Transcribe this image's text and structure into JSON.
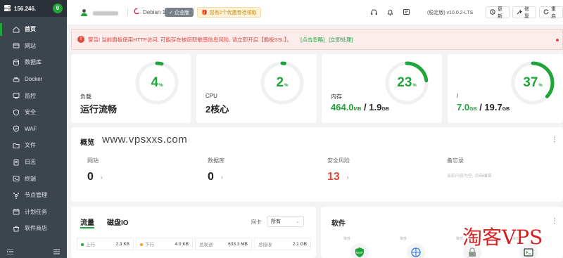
{
  "sidebar": {
    "server_ip": "156.246.",
    "badge": "0",
    "items": [
      {
        "label": "首页",
        "icon": "home-icon"
      },
      {
        "label": "网站",
        "icon": "globe-icon"
      },
      {
        "label": "数据库",
        "icon": "database-icon"
      },
      {
        "label": "Docker",
        "icon": "docker-icon"
      },
      {
        "label": "监控",
        "icon": "monitor-icon"
      },
      {
        "label": "安全",
        "icon": "shield-icon"
      },
      {
        "label": "WAF",
        "icon": "waf-icon"
      },
      {
        "label": "文件",
        "icon": "folder-icon"
      },
      {
        "label": "日志",
        "icon": "log-icon"
      },
      {
        "label": "终端",
        "icon": "terminal-icon"
      },
      {
        "label": "节点管理",
        "icon": "node-icon"
      },
      {
        "label": "计划任务",
        "icon": "calendar-icon"
      },
      {
        "label": "软件商店",
        "icon": "store-icon"
      }
    ]
  },
  "topbar": {
    "os": "Debian 11",
    "edition": "企业版",
    "promo": "您有2个优惠券待领取",
    "version": "(稳定版) v10.0.2-LTS",
    "buttons": {
      "update": "更新",
      "repair": "修复",
      "restart": "重启"
    }
  },
  "warning": {
    "text": "警告! 当前面板使用HTTP访问, 可能存在被窃取敏感信息风险, 请立即开启【面板SSL】。",
    "link1": "[点击忽略]",
    "link2": "[立即处理]"
  },
  "stats": {
    "load": {
      "label": "负载",
      "value": "运行流畅",
      "percent": 4
    },
    "cpu": {
      "label": "CPU",
      "value": "2核心",
      "percent": 2
    },
    "memory": {
      "label": "内存",
      "used": "464.0",
      "used_unit": "MB",
      "total": "1.9",
      "total_unit": "GB",
      "percent": 23
    },
    "disk": {
      "label": "/",
      "used": "7.0",
      "used_unit": "GB",
      "total": "19.7",
      "total_unit": "GB",
      "percent": 37
    },
    "percent_sign": "%"
  },
  "overview": {
    "title": "概览",
    "site": "www.vpsxxs.com",
    "items": {
      "sites": {
        "label": "网站",
        "value": "0"
      },
      "databases": {
        "label": "数据库",
        "value": "0"
      },
      "risk": {
        "label": "安全风险",
        "value": "13"
      },
      "memo": {
        "label": "备忘录",
        "text": "当前内容为空, 点击编辑"
      }
    }
  },
  "traffic": {
    "tab1": "流量",
    "tab2": "磁盘IO",
    "nic_label": "网卡",
    "nic_value": "所有",
    "up_label": "上行",
    "up_value": "2.3 KB",
    "down_label": "下行",
    "down_value": "4.0 KB",
    "sent_label": "总发送",
    "sent_value": "633.3 MB",
    "recv_label": "总接收",
    "recv_value": "2.1 GB"
  },
  "software": {
    "title": "软件",
    "item_label": "推荐",
    "items": [
      "waf-icon",
      "network-icon",
      "lock-icon",
      "terminal-icon"
    ]
  },
  "watermark": "淘客VPS",
  "colors": {
    "accent": "#20a53a",
    "danger": "#e2493f",
    "sidebar": "#3c444d"
  }
}
